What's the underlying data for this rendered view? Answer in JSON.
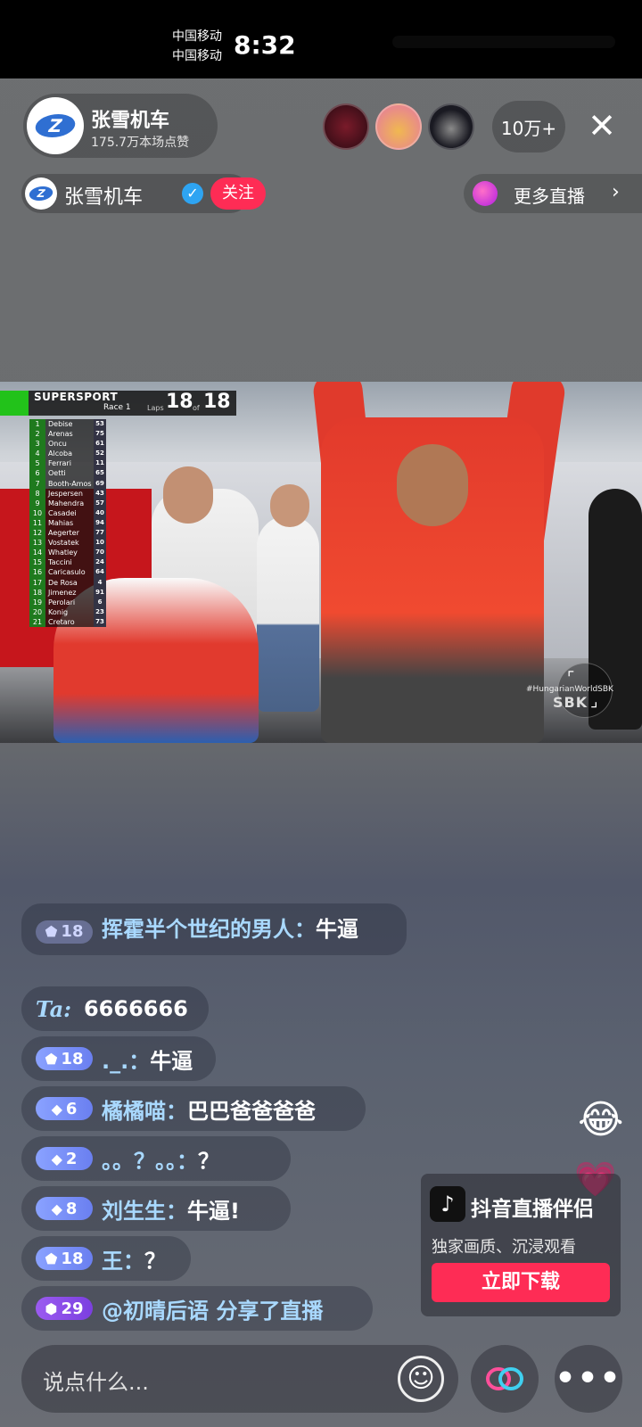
{
  "status_bar": {
    "carrier_1": "中国移动",
    "carrier_2": "中国移动",
    "time": "8:32"
  },
  "anchor": {
    "logo": "Z",
    "name": "张雪机车",
    "likes": "175.7万本场点赞"
  },
  "viewers": {
    "count": "10万+"
  },
  "close_icon": "✕",
  "sub_header": {
    "name": "张雪机车",
    "verified_icon": "✓",
    "follow_label": "关注"
  },
  "more_live": {
    "label": "更多直播",
    "chevron": "›"
  },
  "video_overlay": {
    "series": "SUPERSPORT",
    "race": "Race 1",
    "laps_label": "Laps",
    "lap_current": "18",
    "of_label": "of",
    "lap_total": "18",
    "hashtag": "#HungarianWorldSBK",
    "sbk_logo": "SBK",
    "ranking": [
      {
        "pos": "1",
        "name": "Debise",
        "num": "53"
      },
      {
        "pos": "2",
        "name": "Arenas",
        "num": "75"
      },
      {
        "pos": "3",
        "name": "Oncu",
        "num": "61"
      },
      {
        "pos": "4",
        "name": "Alcoba",
        "num": "52"
      },
      {
        "pos": "5",
        "name": "Ferrari",
        "num": "11"
      },
      {
        "pos": "6",
        "name": "Oetti",
        "num": "65"
      },
      {
        "pos": "7",
        "name": "Booth-Amos",
        "num": "69"
      },
      {
        "pos": "8",
        "name": "Jespersen",
        "num": "43"
      },
      {
        "pos": "9",
        "name": "Mahendra",
        "num": "57"
      },
      {
        "pos": "10",
        "name": "Casadei",
        "num": "40"
      },
      {
        "pos": "11",
        "name": "Mahias",
        "num": "94"
      },
      {
        "pos": "12",
        "name": "Aegerter",
        "num": "77"
      },
      {
        "pos": "13",
        "name": "Vostatek",
        "num": "10"
      },
      {
        "pos": "14",
        "name": "Whatley",
        "num": "70"
      },
      {
        "pos": "15",
        "name": "Taccini",
        "num": "24"
      },
      {
        "pos": "16",
        "name": "Caricasulo",
        "num": "64"
      },
      {
        "pos": "17",
        "name": "De Rosa",
        "num": "4"
      },
      {
        "pos": "18",
        "name": "Jimenez",
        "num": "91"
      },
      {
        "pos": "19",
        "name": "Perolari",
        "num": "6"
      },
      {
        "pos": "20",
        "name": "Konig",
        "num": "23"
      },
      {
        "pos": "21",
        "name": "Cretaro",
        "num": "73"
      }
    ]
  },
  "chat": [
    {
      "level": "18",
      "user": "挥霍半个世纪的男人：",
      "text": "牛逼"
    },
    {
      "level": "",
      "user": "Ta:",
      "text": "6666666"
    },
    {
      "level": "18",
      "user": "._.：",
      "text": "牛逼"
    },
    {
      "level": "6",
      "user": "橘橘喵：",
      "text": "巴巴爸爸爸爸"
    },
    {
      "level": "2",
      "user": "。。？。。：",
      "text": "？"
    },
    {
      "level": "8",
      "user": "刘生生：",
      "text": "牛逼!"
    },
    {
      "level": "18",
      "user": "王：",
      "text": "？"
    },
    {
      "level": "29",
      "user": "@初晴后语 分享了直播",
      "text": ""
    }
  ],
  "promo": {
    "title": "抖音直播伴侣",
    "subtitle": "独家画质、沉浸观看",
    "button": "立即下载"
  },
  "bottom": {
    "placeholder": "说点什么...",
    "emoji_icon": "☺",
    "more_icon": "•••"
  },
  "colors": {
    "accent": "#fe2c55",
    "user_name": "#a9d9ff",
    "badge": "#8aa2ff"
  }
}
